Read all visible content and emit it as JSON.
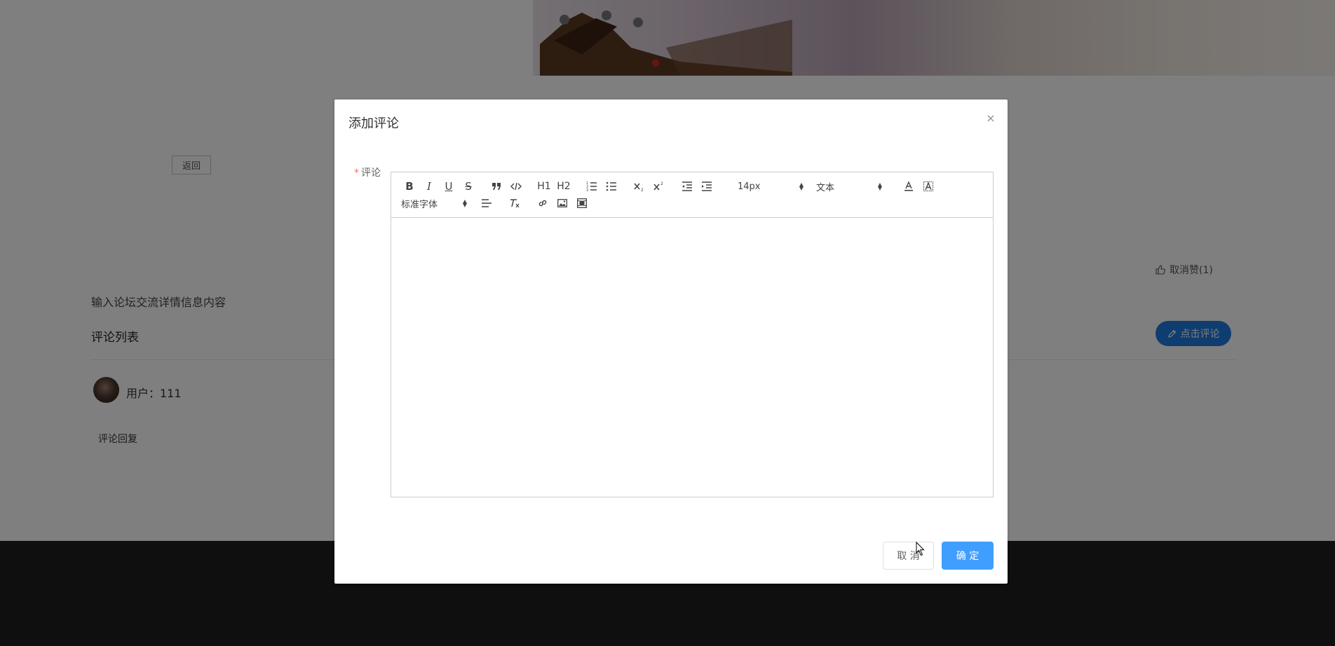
{
  "page": {
    "back_label": "返回",
    "like_label": "取消赞(1)",
    "detail_text": "输入论坛交流详情信息内容",
    "comment_list_title": "评论列表",
    "comment_button_label": "点击评论",
    "comment": {
      "user": "用户：111",
      "reply_label": "评论回复"
    }
  },
  "dialog": {
    "title": "添加评论",
    "close_symbol": "×",
    "field_label": "评论",
    "required_mark": "*",
    "toolbar": {
      "bold": "B",
      "italic": "I",
      "underline": "U",
      "strike": "S",
      "h1": "H1",
      "h2": "H2",
      "font_size": "14px",
      "header_select": "文本",
      "font_family": "标准字体"
    },
    "editor_content": "",
    "cancel_label": "取 消",
    "ok_label": "确 定"
  },
  "colors": {
    "primary": "#409eff",
    "comment_button": "#1e7ae0",
    "footer": "#1f1f1f",
    "required": "#f56c6c"
  }
}
